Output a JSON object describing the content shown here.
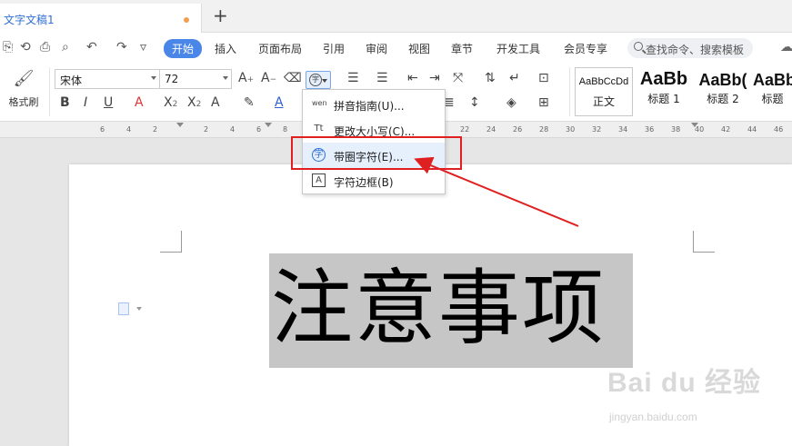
{
  "tab": {
    "title": "文字文稿1",
    "new_tab": "+"
  },
  "quick_access": [
    "⎘",
    "⟲",
    "⎙",
    "⌕",
    "↶",
    "↷",
    "▿"
  ],
  "menu": {
    "items": [
      "开始",
      "插入",
      "页面布局",
      "引用",
      "审阅",
      "视图",
      "章节",
      "开发工具",
      "会员专享"
    ],
    "active": "开始",
    "search_placeholder": "查找命令、搜索模板"
  },
  "ribbon": {
    "format_painter": "格式刷",
    "font_name": "宋体",
    "font_size": "72",
    "styles": [
      {
        "sample": "AaBbCcDd",
        "name": "正文"
      },
      {
        "sample": "AaBb",
        "name": "标题 1"
      },
      {
        "sample": "AaBb(",
        "name": "标题 2"
      },
      {
        "sample": "AaBb",
        "name": "标题"
      }
    ]
  },
  "ruler": {
    "numbers": [
      "6",
      "4",
      "2",
      "2",
      "4",
      "6",
      "8",
      "22",
      "24",
      "26",
      "28",
      "30",
      "32",
      "34",
      "36",
      "38",
      "40",
      "42",
      "44",
      "46"
    ]
  },
  "dropdown": {
    "items": [
      {
        "label": "拼音指南(U)...",
        "icon": "wen"
      },
      {
        "label": "更改大小写(C)...",
        "icon": "Tt"
      },
      {
        "label": "带圈字符(E)...",
        "icon": "字"
      },
      {
        "label": "字符边框(B)",
        "icon": "A"
      }
    ]
  },
  "document": {
    "text": "注意事项"
  },
  "watermark": {
    "brand": "Bai du 经验",
    "url": "jingyan.baidu.com"
  },
  "colors": {
    "accent": "#4a86e8",
    "highlight": "#c6c6c6",
    "annotation": "#e02020"
  }
}
